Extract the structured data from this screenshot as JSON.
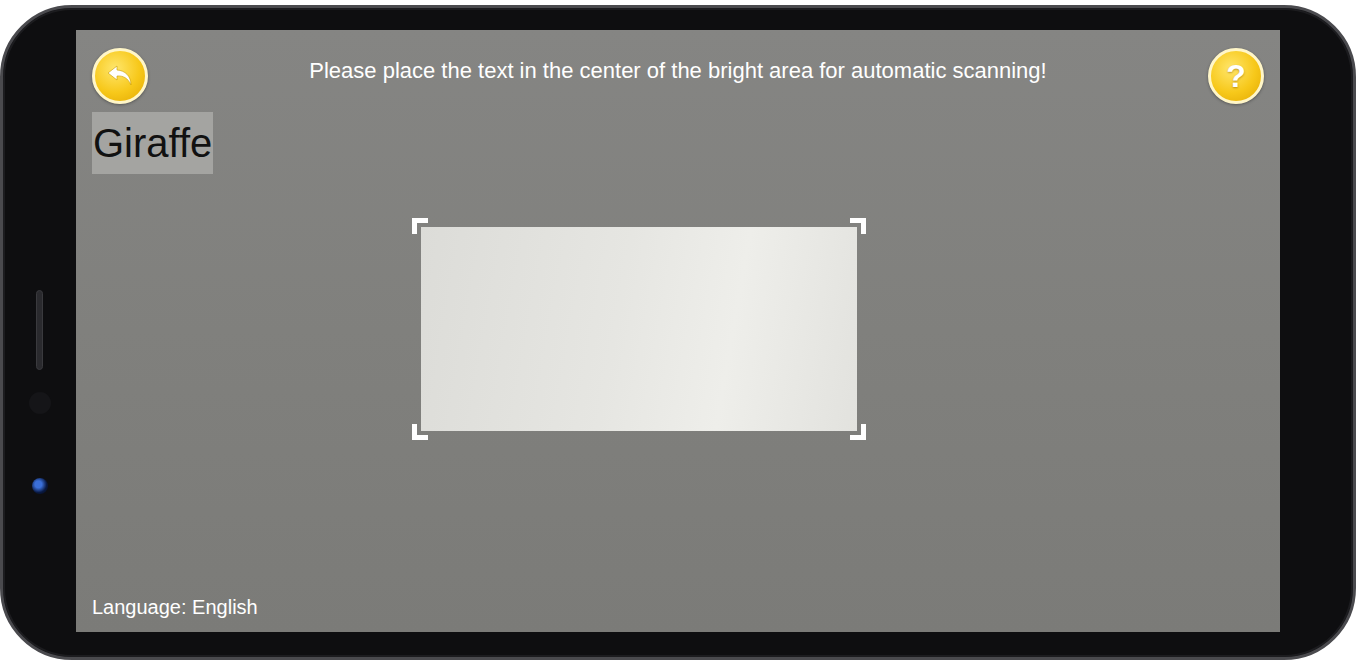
{
  "header": {
    "instruction": "Please place the text in the center of the bright area for automatic scanning!",
    "help_icon": "?"
  },
  "result": {
    "text": "Giraffe"
  },
  "footer": {
    "language": "Language: English"
  }
}
